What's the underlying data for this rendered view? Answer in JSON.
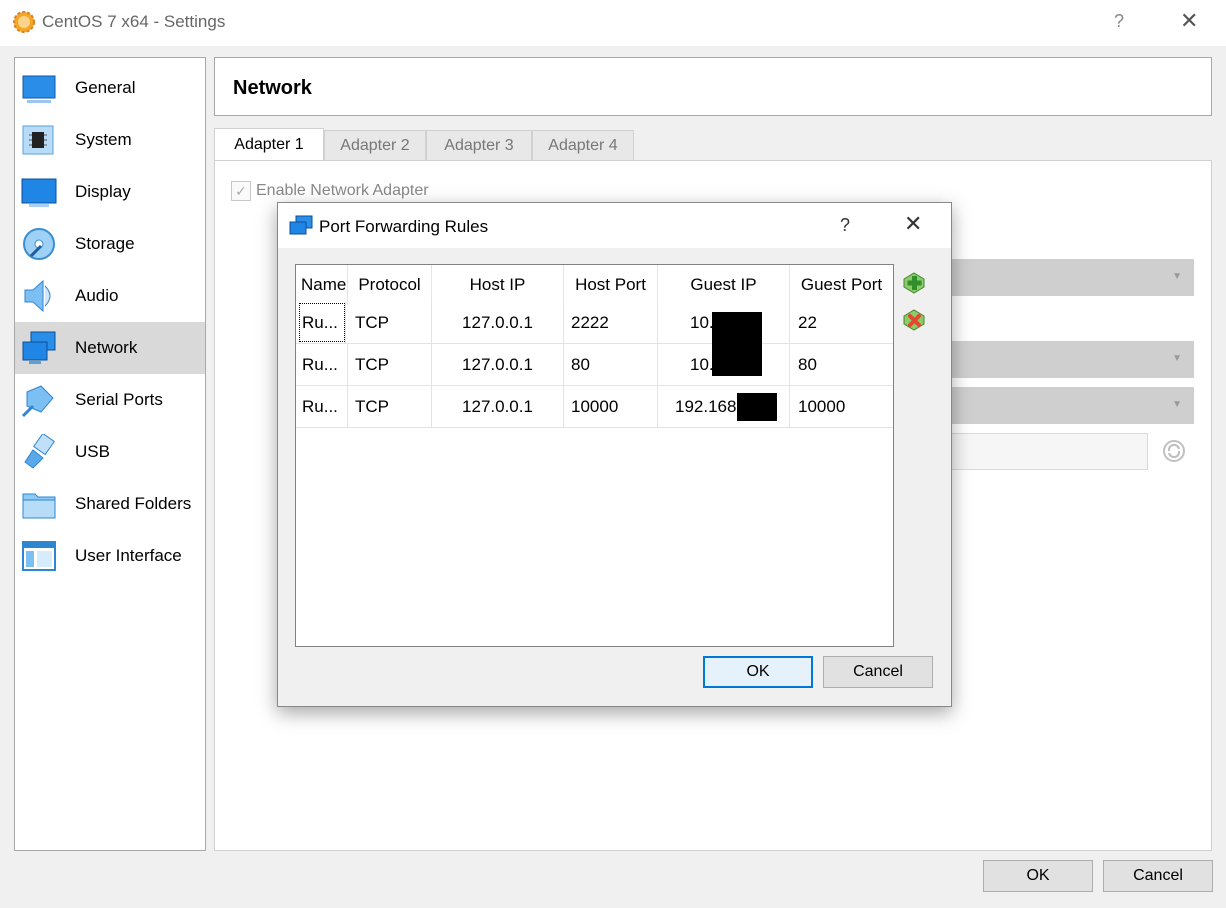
{
  "window": {
    "title": "CentOS 7 x64 - Settings",
    "help": "?",
    "close": "✕"
  },
  "sidebar": {
    "items": [
      {
        "label": "General",
        "icon": "general-icon"
      },
      {
        "label": "System",
        "icon": "chip-icon"
      },
      {
        "label": "Display",
        "icon": "monitor-icon"
      },
      {
        "label": "Storage",
        "icon": "disk-icon"
      },
      {
        "label": "Audio",
        "icon": "speaker-icon"
      },
      {
        "label": "Network",
        "icon": "network-icon",
        "selected": true
      },
      {
        "label": "Serial Ports",
        "icon": "serial-port-icon"
      },
      {
        "label": "USB",
        "icon": "usb-icon"
      },
      {
        "label": "Shared Folders",
        "icon": "folder-icon"
      },
      {
        "label": "User Interface",
        "icon": "user-interface-icon"
      }
    ]
  },
  "header": {
    "title": "Network"
  },
  "tabs": [
    {
      "label": "Adapter 1",
      "active": true
    },
    {
      "label": "Adapter 2"
    },
    {
      "label": "Adapter 3"
    },
    {
      "label": "Adapter 4"
    }
  ],
  "adapter": {
    "enable_label": "Enable Network Adapter",
    "enabled": true
  },
  "buttons": {
    "ok": "OK",
    "cancel": "Cancel"
  },
  "dialog": {
    "title": "Port Forwarding Rules",
    "help": "?",
    "close": "✕",
    "columns": [
      "Name",
      "Protocol",
      "Host IP",
      "Host Port",
      "Guest IP",
      "Guest Port"
    ],
    "rows": [
      {
        "name": "Ru...",
        "protocol": "TCP",
        "host_ip": "127.0.0.1",
        "host_port": "2222",
        "guest_ip": "10.",
        "guest_port": "22"
      },
      {
        "name": "Ru...",
        "protocol": "TCP",
        "host_ip": "127.0.0.1",
        "host_port": "80",
        "guest_ip": "10.",
        "guest_port": "80"
      },
      {
        "name": "Ru...",
        "protocol": "TCP",
        "host_ip": "127.0.0.1",
        "host_port": "10000",
        "guest_ip": "192.168",
        "guest_port": "10000"
      }
    ],
    "ok": "OK",
    "cancel": "Cancel",
    "add_icon": "add-rule-icon",
    "remove_icon": "remove-rule-icon"
  },
  "colors": {
    "accent": "#0078d7",
    "selected": "#d9d9d9",
    "icon_blue": "#1e88e5",
    "add_green": "#3fa535",
    "remove_red": "#e04a2f"
  }
}
